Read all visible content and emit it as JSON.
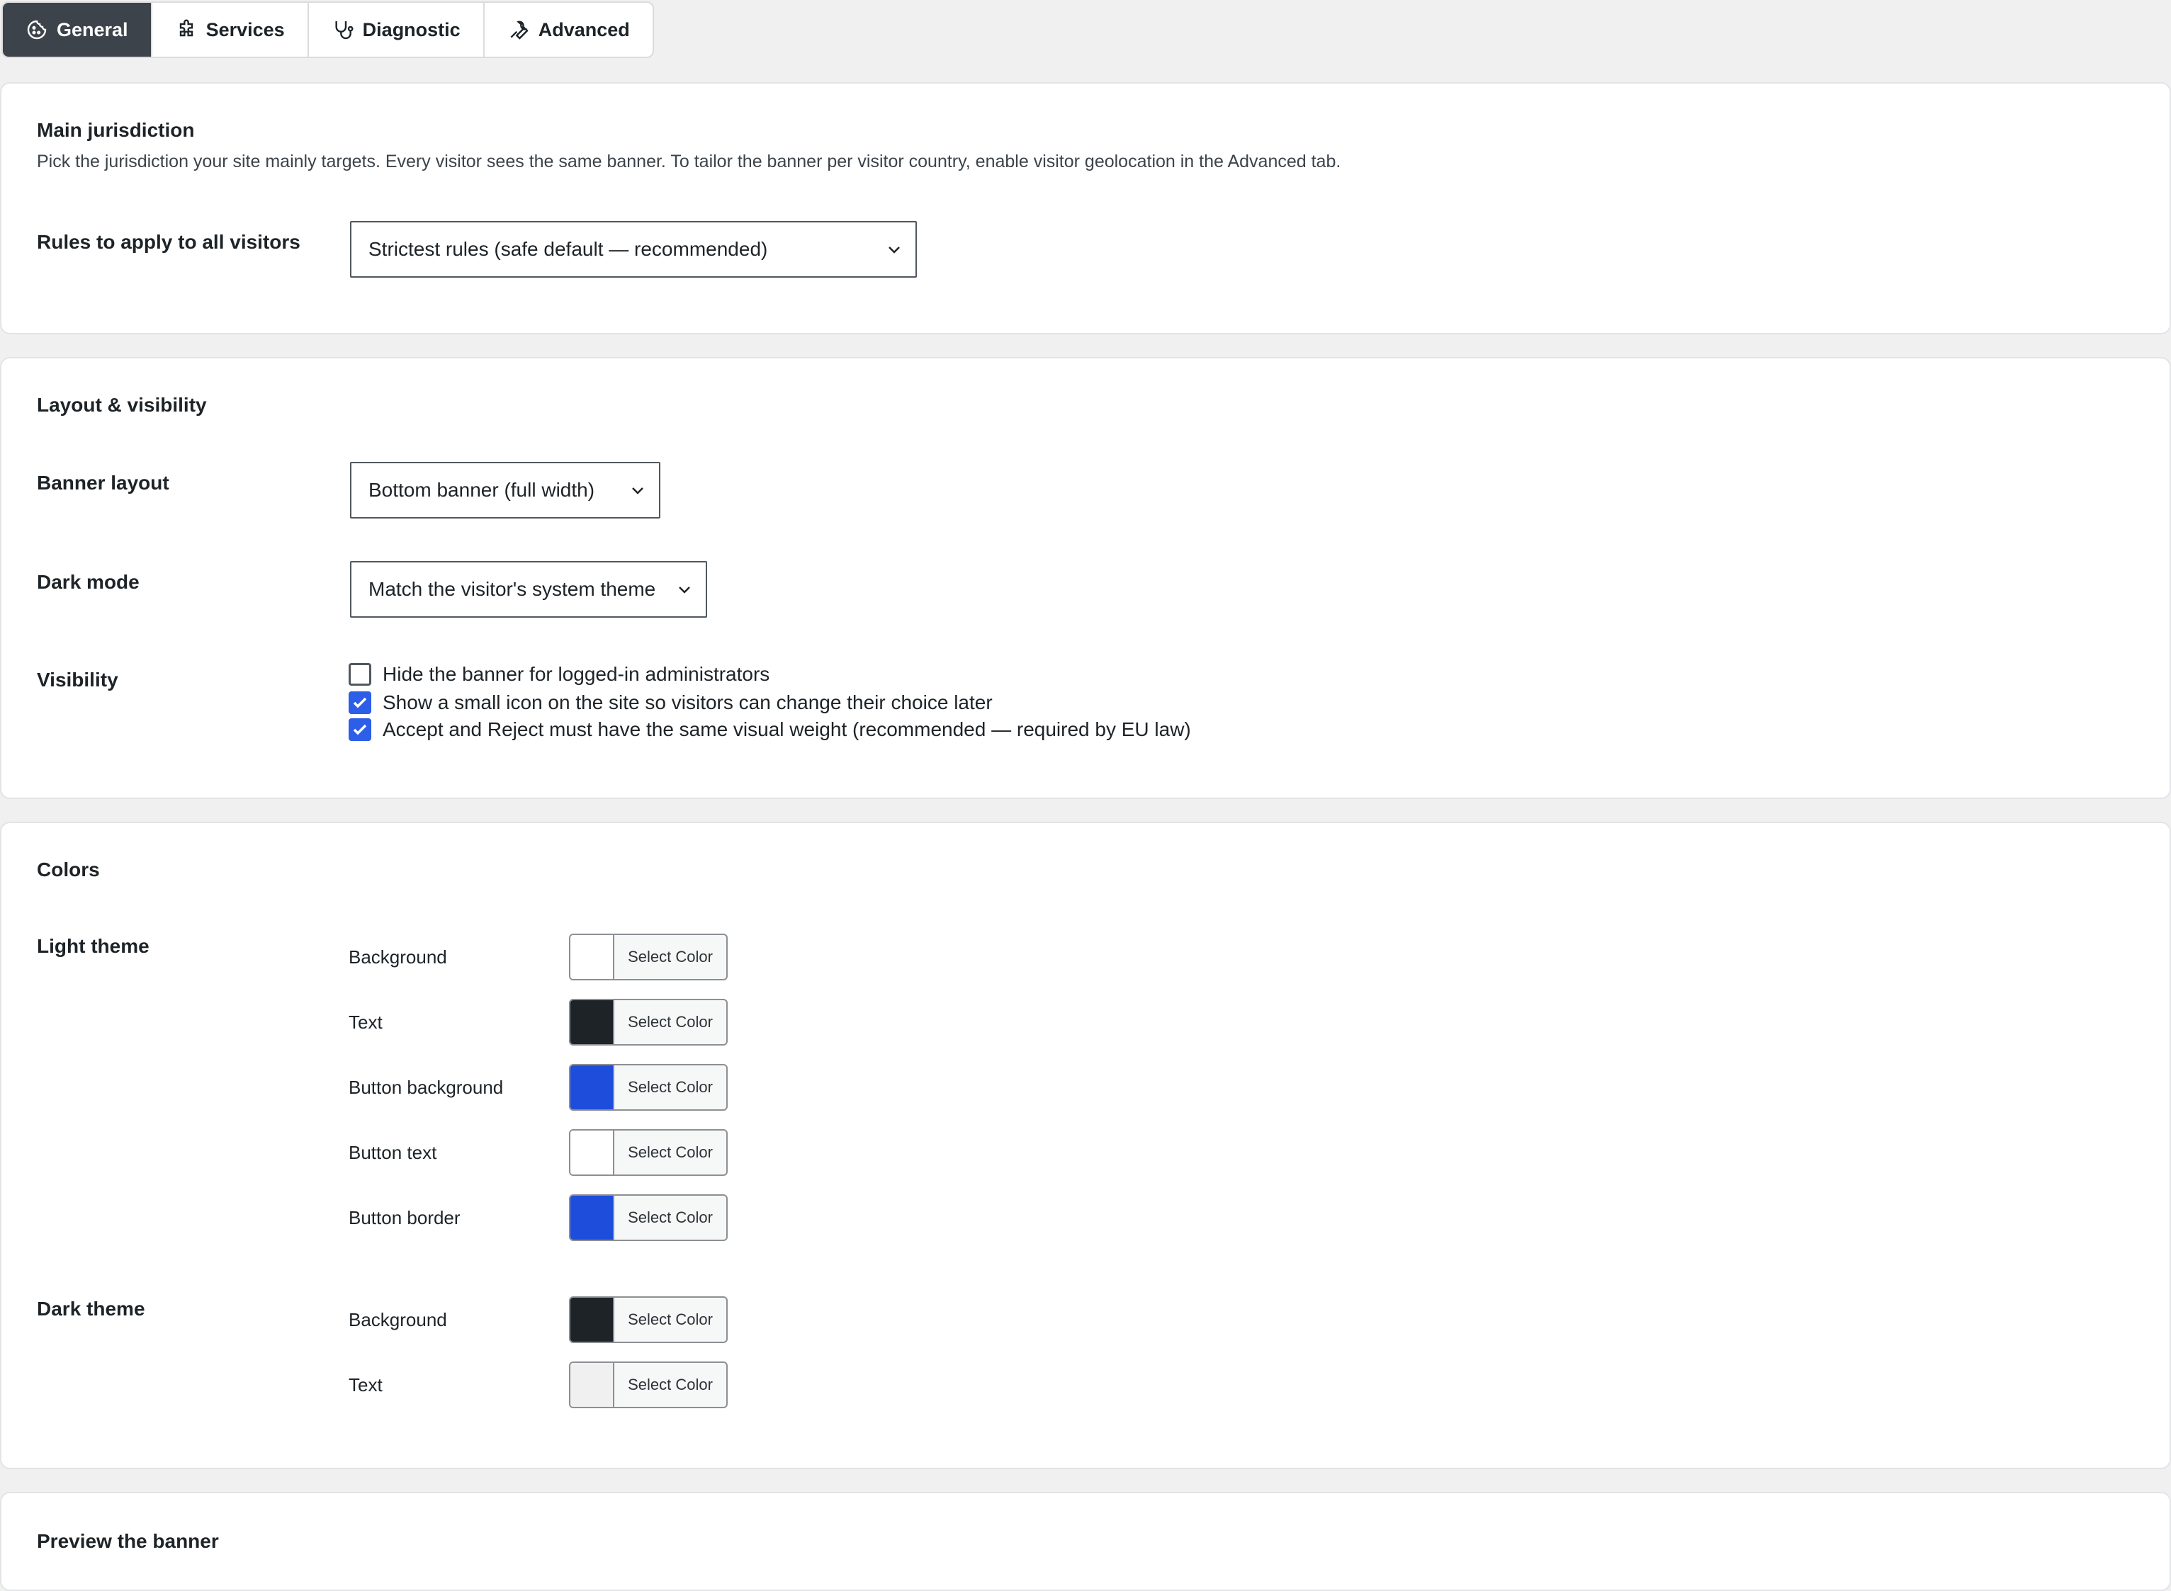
{
  "tabs": [
    {
      "label": "General",
      "icon": "cookie-icon"
    },
    {
      "label": "Services",
      "icon": "puzzle-icon"
    },
    {
      "label": "Diagnostic",
      "icon": "stethoscope-icon"
    },
    {
      "label": "Advanced",
      "icon": "wrench-icon"
    }
  ],
  "jurisdiction": {
    "title": "Main jurisdiction",
    "description": "Pick the jurisdiction your site mainly targets. Every visitor sees the same banner. To tailor the banner per visitor country, enable visitor geolocation in the Advanced tab.",
    "rules_label": "Rules to apply to all visitors",
    "rules_value": "Strictest rules (safe default — recommended)"
  },
  "layout": {
    "title": "Layout & visibility",
    "banner_layout_label": "Banner layout",
    "banner_layout_value": "Bottom banner (full width)",
    "dark_mode_label": "Dark mode",
    "dark_mode_value": "Match the visitor's system theme",
    "visibility_label": "Visibility",
    "checkboxes": [
      {
        "label": "Hide the banner for logged-in administrators",
        "checked": false
      },
      {
        "label": "Show a small icon on the site so visitors can change their choice later",
        "checked": true
      },
      {
        "label": "Accept and Reject must have the same visual weight (recommended — required by EU law)",
        "checked": true
      }
    ]
  },
  "colors": {
    "title": "Colors",
    "select_color_label": "Select Color",
    "light_theme_label": "Light theme",
    "light": [
      {
        "label": "Background",
        "color": "#ffffff"
      },
      {
        "label": "Text",
        "color": "#1d2327"
      },
      {
        "label": "Button background",
        "color": "#1e4ddb"
      },
      {
        "label": "Button text",
        "color": "#ffffff"
      },
      {
        "label": "Button border",
        "color": "#1e4ddb"
      }
    ],
    "dark_theme_label": "Dark theme",
    "dark": [
      {
        "label": "Background",
        "color": "#1d2327"
      },
      {
        "label": "Text",
        "color": "#f0f0f1"
      }
    ]
  },
  "preview": {
    "title": "Preview the banner"
  }
}
